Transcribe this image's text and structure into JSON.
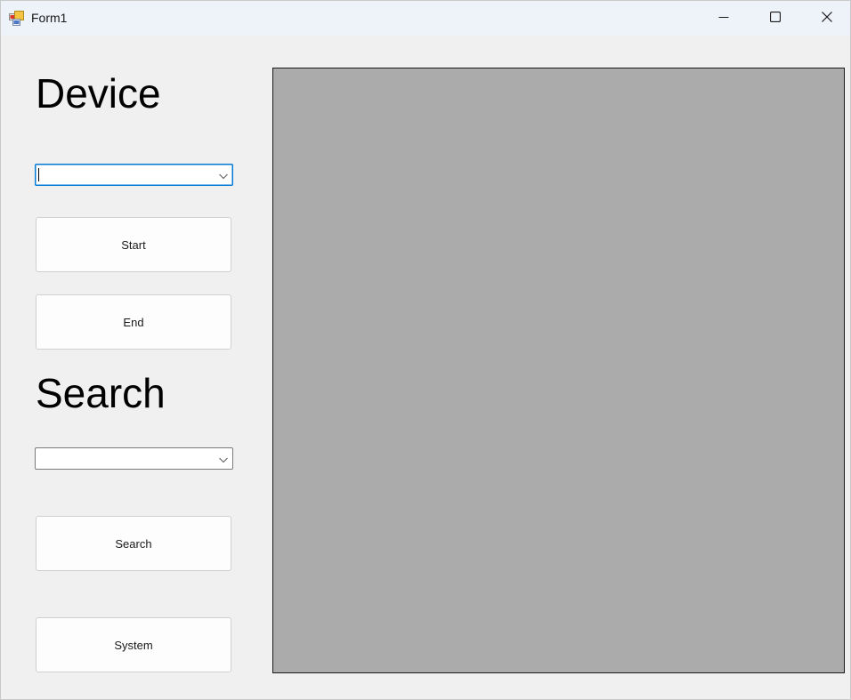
{
  "window": {
    "title": "Form1",
    "icon": "winforms-app-icon",
    "controls": {
      "minimize": "minimize-icon",
      "maximize": "maximize-icon",
      "close": "close-icon"
    }
  },
  "device": {
    "heading": "Device",
    "combo": {
      "value": "",
      "icon": "chevron-down-icon"
    },
    "start_label": "Start",
    "end_label": "End"
  },
  "search": {
    "heading": "Search",
    "combo": {
      "value": "",
      "icon": "chevron-down-icon"
    },
    "search_label": "Search",
    "system_label": "System"
  },
  "colors": {
    "form_background": "#f0f0f0",
    "titlebar_background": "#eef2f9",
    "display_panel": "#ababab",
    "focus_accent": "#0078d4"
  }
}
